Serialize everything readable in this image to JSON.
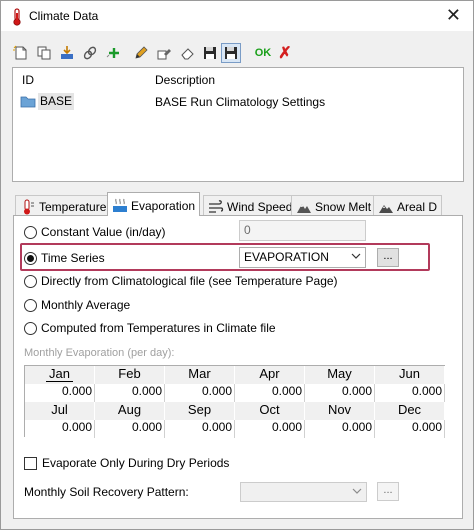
{
  "window": {
    "title": "Climate Data",
    "close_glyph": "✕"
  },
  "toolbar": {
    "buttons": [
      {
        "name": "new-icon"
      },
      {
        "name": "copy-icon"
      },
      {
        "name": "import-icon"
      },
      {
        "name": "link-icon"
      },
      {
        "name": "add-icon"
      },
      {
        "name": "edit-icon"
      },
      {
        "name": "rename-icon"
      },
      {
        "name": "erase-icon"
      },
      {
        "name": "save-icon"
      },
      {
        "name": "save-as-icon"
      }
    ],
    "ok_label": "OK",
    "cancel_glyph": "✗"
  },
  "list": {
    "columns": [
      "ID",
      "Description"
    ],
    "rows": [
      {
        "id": "BASE",
        "description": "BASE Run Climatology Settings"
      }
    ]
  },
  "tabs": [
    {
      "label": "Temperature",
      "icon": "thermometer-icon"
    },
    {
      "label": "Evaporation",
      "icon": "evaporation-icon",
      "active": true
    },
    {
      "label": "Wind Speed",
      "icon": "wind-icon"
    },
    {
      "label": "Snow Melt",
      "icon": "mountain-icon"
    },
    {
      "label": "Areal D",
      "icon": "areal-depletion-icon"
    }
  ],
  "evaporation": {
    "options": {
      "constant": "Constant Value (in/day)",
      "time_series": "Time Series",
      "from_file": "Directly from Climatological file (see Temperature Page)",
      "monthly_avg": "Monthly Average",
      "computed": "Computed from Temperatures in Climate file"
    },
    "selected_option": "time_series",
    "constant_value": "0",
    "time_series_value": "EVAPORATION",
    "browse_label": "...",
    "monthly_label": "Monthly Evaporation (per day):",
    "months_row1": [
      "Jan",
      "Feb",
      "Mar",
      "Apr",
      "May",
      "Jun"
    ],
    "values_row1": [
      "0.000",
      "0.000",
      "0.000",
      "0.000",
      "0.000",
      "0.000"
    ],
    "months_row2": [
      "Jul",
      "Aug",
      "Sep",
      "Oct",
      "Nov",
      "Dec"
    ],
    "values_row2": [
      "0.000",
      "0.000",
      "0.000",
      "0.000",
      "0.000",
      "0.000"
    ],
    "dry_only_label": "Evaporate Only During Dry Periods",
    "soil_recovery_label": "Monthly Soil Recovery Pattern:",
    "soil_recovery_value": ""
  },
  "colors": {
    "highlight": "#b23a5b",
    "ok_green": "#1aa01a",
    "cancel_red": "#d42020"
  }
}
